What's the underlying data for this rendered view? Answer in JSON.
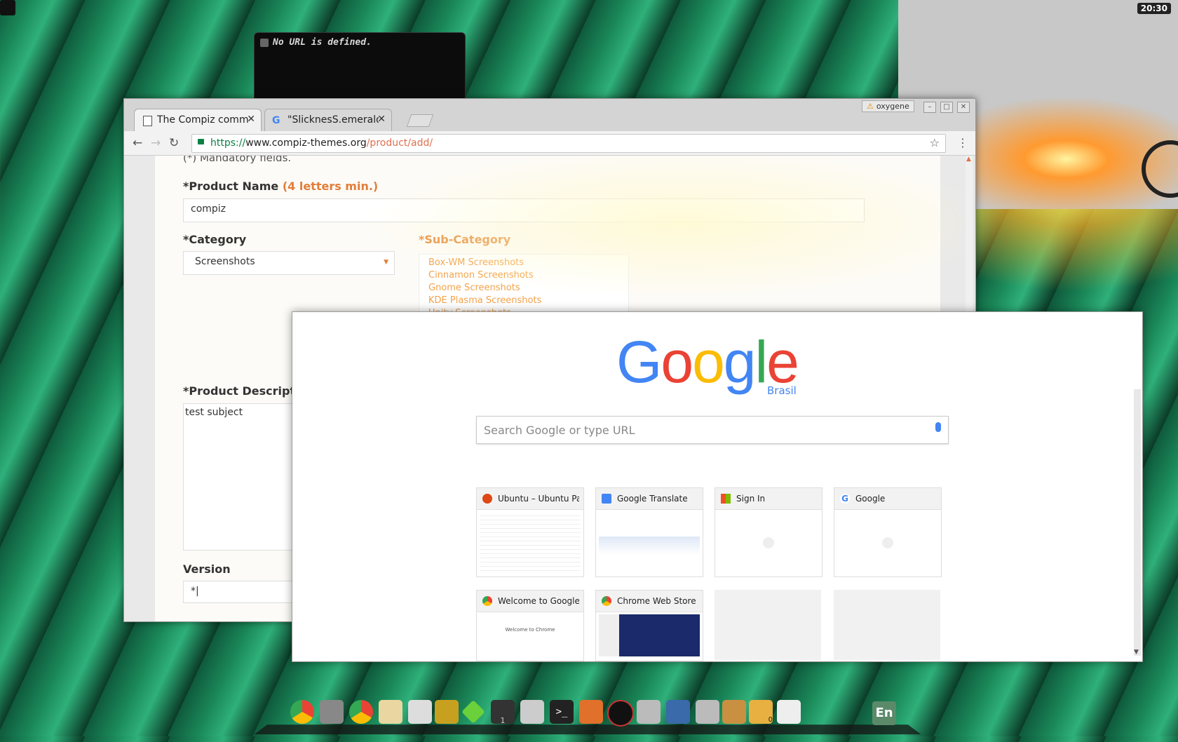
{
  "desktop": {
    "clock": "20:30",
    "feed_widget_text": "No URL is defined.",
    "keyboard_layout": "En",
    "workspace_number": "1",
    "dock_badge": "0"
  },
  "browser1": {
    "tabs": [
      {
        "label": "The Compiz commun",
        "active": true
      },
      {
        "label": "\"SlicknesS.emerald\"",
        "active": false
      }
    ],
    "wm_theme_label": "oxygene",
    "url": {
      "scheme": "https://",
      "domain": "www.compiz-themes.org",
      "path": "/product/add/"
    },
    "page": {
      "mandatory_note": "(*) Mandatory fields.",
      "product_name_label_prefix": "*Product Name",
      "product_name_label_suffix": "(4 letters min.)",
      "product_name_value": "compiz",
      "category_label": "*Category",
      "category_value": "Screenshots",
      "subcategory_label": "*Sub-Category",
      "subcategory_options": [
        "Box-WM Screenshots",
        "Cinnamon Screenshots",
        "Gnome Screenshots",
        "KDE Plasma Screenshots",
        "Unity Screenshots"
      ],
      "description_label": "*Product Descripti",
      "description_value": "test subject",
      "version_label": "Version",
      "version_value": "*|"
    }
  },
  "browser2": {
    "logo_text": "Google",
    "logo_sub": "Brasil",
    "search_placeholder": "Search Google or type URL",
    "tiles": [
      {
        "title": "Ubuntu – Ubuntu Pack",
        "favicon_color": "#dd4814"
      },
      {
        "title": "Google Translate",
        "favicon_color": "#4285f4"
      },
      {
        "title": "Sign In",
        "favicon_color": "#f25022"
      },
      {
        "title": "Google",
        "favicon_color": "#4285f4"
      },
      {
        "title": "Welcome to Google C",
        "favicon_color": "#34a853"
      },
      {
        "title": "Chrome Web Store",
        "favicon_color": "#ea4335"
      }
    ],
    "chrome_welcome_thumb_text": "Welcome to Chrome"
  }
}
